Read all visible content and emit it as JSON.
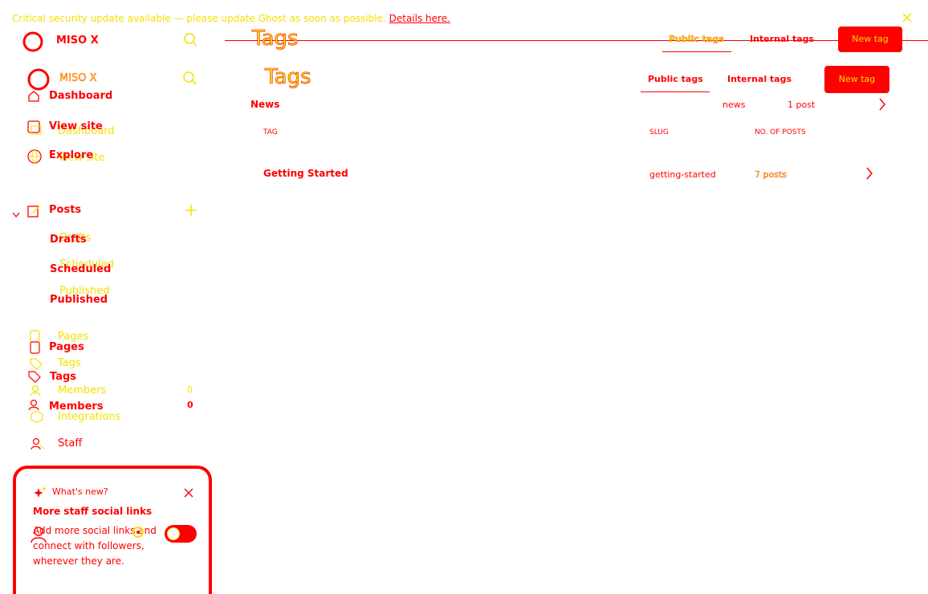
{
  "banner": {
    "message": "Critical security update available — please update Ghost as soon as possible.",
    "link": "Details here."
  },
  "brand": {
    "name": "MISO X"
  },
  "page": {
    "title": "Tags",
    "tab_public": "Public tags",
    "tab_internal": "Internal tags",
    "new_tag": "New tag"
  },
  "nav": {
    "dashboard": "Dashboard",
    "view_site": "View site",
    "explore": "Explore",
    "posts": "Posts",
    "drafts": "Drafts",
    "scheduled": "Scheduled",
    "published": "Published",
    "pages": "Pages",
    "tags": "Tags",
    "members": "Members",
    "members_count": "0",
    "integrations": "Integrations",
    "staff": "Staff"
  },
  "table": {
    "headers": {
      "tag": "TAG",
      "slug": "SLUG",
      "posts": "NO. OF POSTS"
    },
    "rows": [
      {
        "name": "News",
        "slug": "news",
        "posts": "1 post"
      },
      {
        "name": "Getting Started",
        "slug": "getting-started",
        "posts": "7 posts"
      }
    ]
  },
  "whats_new": {
    "title": "What's new?",
    "heading": "More staff social links",
    "body1": "Add more social links and",
    "body2": "connect with followers,",
    "body3": "wherever they are."
  },
  "colors": {
    "accent": "#ff0000",
    "secondary": "#f5e000",
    "background": "#ffffff"
  }
}
